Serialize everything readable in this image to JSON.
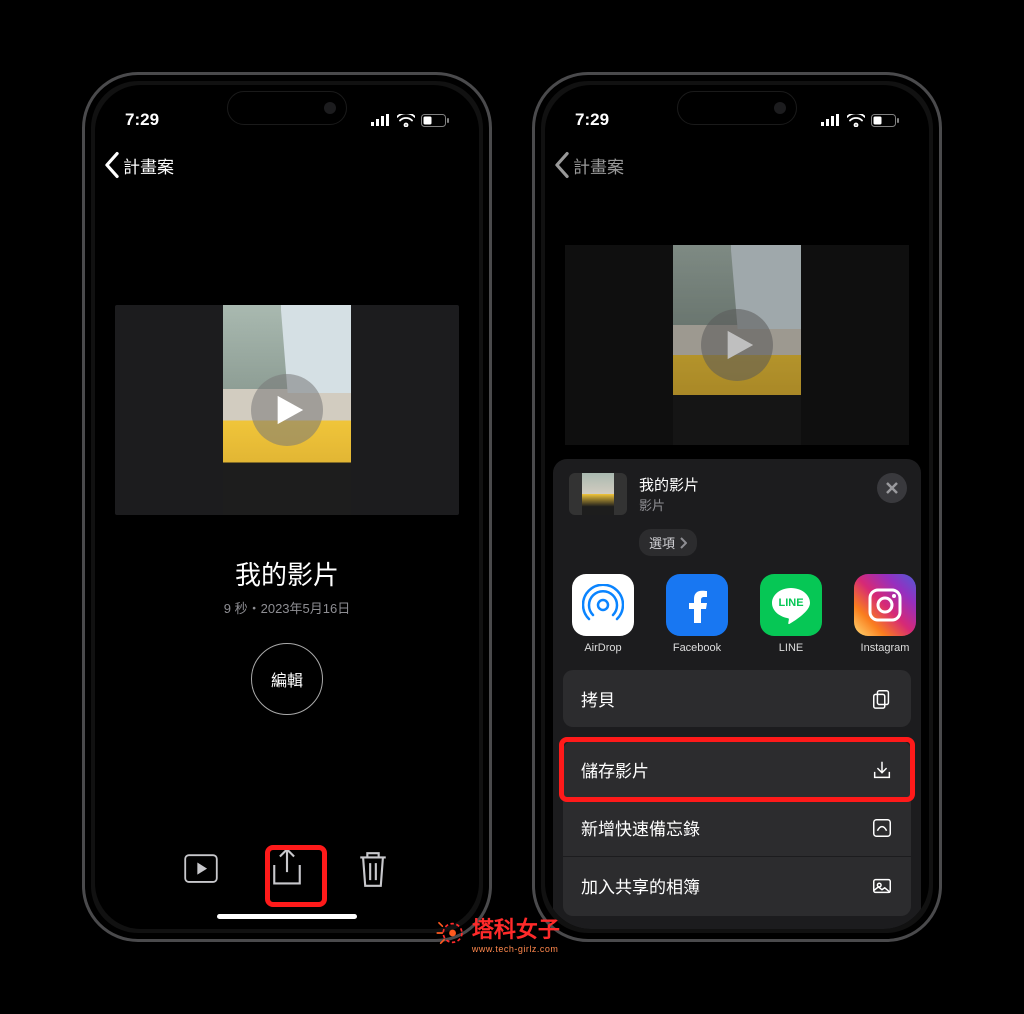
{
  "status": {
    "time": "7:29"
  },
  "nav": {
    "back_label": "計畫案"
  },
  "left": {
    "video_title": "我的影片",
    "video_subtitle": "9 秒・2023年5月16日",
    "edit_label": "編輯"
  },
  "sheet": {
    "title": "我的影片",
    "type_label": "影片",
    "options_label": "選項",
    "share_targets": [
      {
        "id": "airdrop",
        "label": "AirDrop"
      },
      {
        "id": "facebook",
        "label": "Facebook"
      },
      {
        "id": "line",
        "label": "LINE"
      },
      {
        "id": "instagram",
        "label": "Instagram"
      }
    ],
    "actions": {
      "copy": "拷貝",
      "save_video": "儲存影片",
      "quick_note": "新增快速備忘錄",
      "add_shared_album": "加入共享的相簿"
    }
  },
  "watermark": {
    "text": "塔科女子",
    "sub": "www.tech-girlz.com"
  }
}
